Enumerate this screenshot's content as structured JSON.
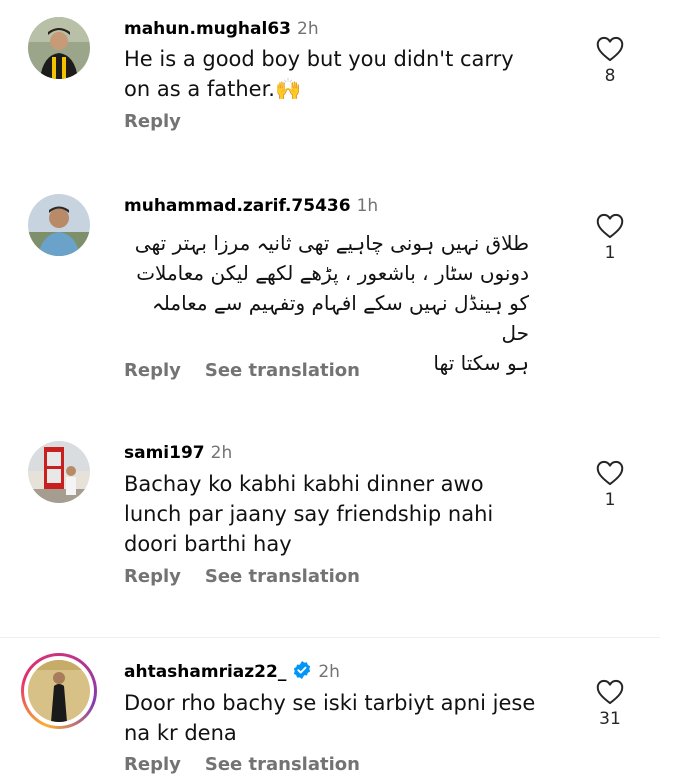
{
  "comments": [
    {
      "username": "mahun.mughal63",
      "time": "2h",
      "text": "He is a good boy but you didn't carry on as a father.🙌",
      "reply": "Reply",
      "like_count": "8"
    },
    {
      "username": "muhammad.zarif.75436",
      "time": "1h",
      "lines": [
        "طلاق نہیں ہونی چاہیے تھی ثانیہ مرزا بہتر تھی",
        "دونوں سٹار ، باشعور ، پڑھے لکھے لیکن معاملات",
        "کو ہینڈل نہیں سکے افہام وتفہیم سے معاملہ حل",
        "ہو سکتا تھا"
      ],
      "reply": "Reply",
      "see_translation": "See translation",
      "like_count": "1"
    },
    {
      "username": "sami197",
      "time": "2h",
      "text": "Bachay ko kabhi kabhi dinner awo lunch par jaany say friendship nahi doori barthi hay",
      "reply": "Reply",
      "see_translation": "See translation",
      "like_count": "1"
    },
    {
      "username": "ahtashamriaz22_",
      "time": "2h",
      "text": "Door rho bachy se iski tarbiyt apni jese na kr dena",
      "reply": "Reply",
      "see_translation": "See translation",
      "like_count": "31",
      "verified": true
    }
  ],
  "colors": {
    "meta_gray": "#737373",
    "verified_blue": "#0095f6",
    "divider": "#efefef"
  },
  "icons": [
    "heart-outline-icon",
    "verified-badge-icon"
  ]
}
